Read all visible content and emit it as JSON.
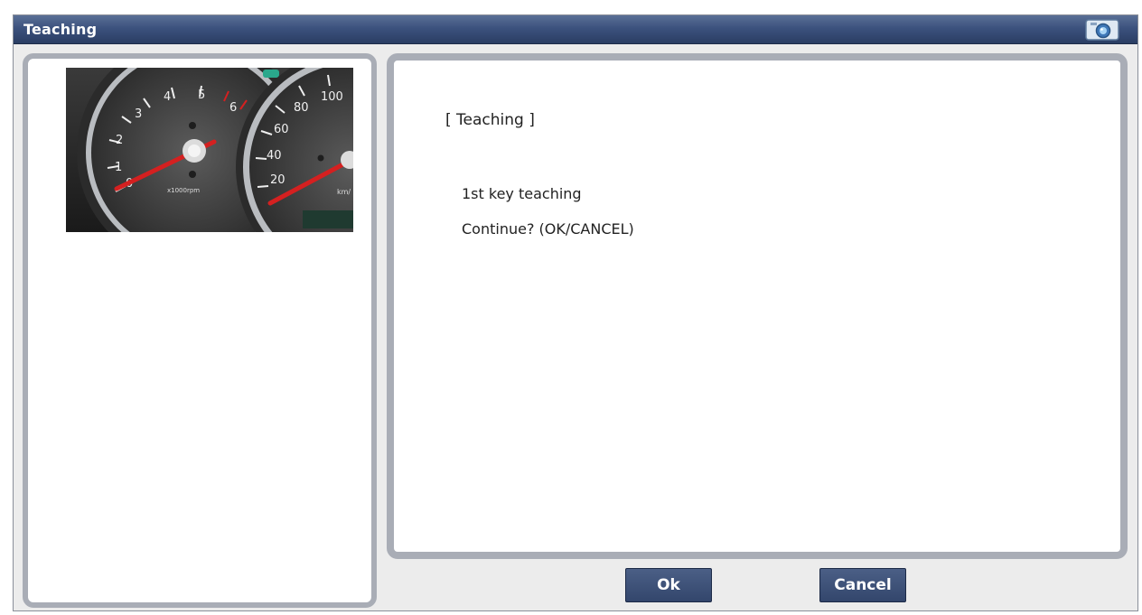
{
  "window": {
    "title": "Teaching",
    "camera_icon": "camera-icon"
  },
  "image_panel": {
    "image": "instrument-cluster-gauges",
    "tachometer_ticks": [
      "0",
      "1",
      "2",
      "3",
      "4",
      "5",
      "6"
    ],
    "tachometer_unit": "x1000rpm",
    "speedometer_ticks": [
      "20",
      "40",
      "60",
      "80",
      "100"
    ],
    "speedometer_unit": "km/"
  },
  "message": {
    "title": "[ Teaching ]",
    "line1": "1st key teaching",
    "line2": "Continue? (OK/CANCEL)"
  },
  "buttons": {
    "ok_label": "Ok",
    "cancel_label": "Cancel"
  },
  "colors": {
    "title_bar": "#3c527e",
    "button": "#3f5279",
    "panel_border": "#a9adb6",
    "needle": "#d42020"
  }
}
